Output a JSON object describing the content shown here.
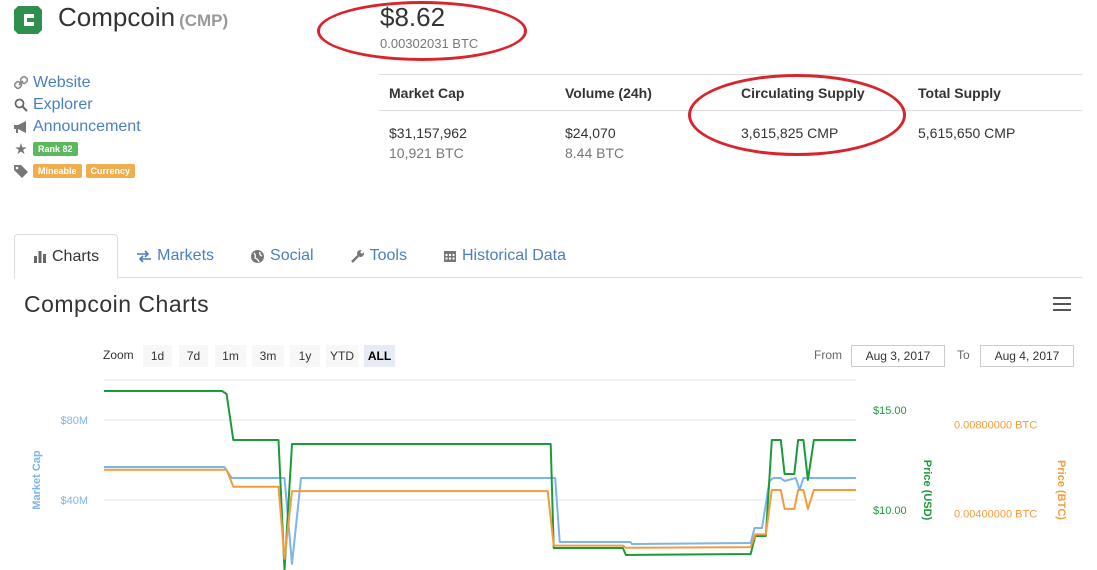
{
  "coin": {
    "name": "Compcoin",
    "symbol": "(CMP)"
  },
  "price": {
    "usd": "$8.62",
    "btc": "0.00302031 BTC"
  },
  "links": {
    "website": "Website",
    "explorer": "Explorer",
    "announcement": "Announcement",
    "rank": "Rank 82",
    "tags": [
      "Mineable",
      "Currency"
    ]
  },
  "stats": {
    "headers": [
      "Market Cap",
      "Volume (24h)",
      "Circulating Supply",
      "Total Supply"
    ],
    "market_cap_usd": "$31,157,962",
    "market_cap_btc": "10,921 BTC",
    "volume_usd": "$24,070",
    "volume_btc": "8.44 BTC",
    "circulating_supply": "3,615,825 CMP",
    "total_supply": "5,615,650 CMP"
  },
  "tabs": [
    "Charts",
    "Markets",
    "Social",
    "Tools",
    "Historical Data"
  ],
  "charts_title": "Compcoin Charts",
  "zoom": {
    "label": "Zoom",
    "buttons": [
      "1d",
      "7d",
      "1m",
      "3m",
      "1y",
      "YTD",
      "ALL"
    ],
    "active": "ALL"
  },
  "range": {
    "from_label": "From",
    "from": "Aug 3, 2017",
    "to_label": "To",
    "to": "Aug 4, 2017"
  },
  "colors": {
    "market_cap": "#7cb5ec",
    "price_usd": "#1a9b3a",
    "price_btc": "#f39c3c",
    "annotation": "#d9242b",
    "link": "#4a7fc0"
  },
  "chart_data": {
    "type": "line",
    "axes": {
      "market_cap": {
        "label": "Market Cap",
        "ticks": [
          "$40M",
          "$80M"
        ],
        "range": [
          0,
          100
        ]
      },
      "price_usd": {
        "label": "Price (USD)",
        "ticks": [
          "$10.00",
          "$15.00"
        ],
        "range": [
          6.5,
          16.5
        ]
      },
      "price_btc": {
        "label": "Price (BTC)",
        "ticks": [
          "0.00400000 BTC",
          "0.00800000 BTC"
        ],
        "range": [
          0.001,
          0.01
        ]
      }
    },
    "series": [
      {
        "name": "Market Cap",
        "axis": "market_cap",
        "color": "#7cb5ec",
        "values": [
          [
            0,
            56.5
          ],
          [
            0.16,
            56.5
          ],
          [
            0.17,
            51
          ],
          [
            0.24,
            51
          ],
          [
            0.25,
            8
          ],
          [
            0.262,
            51
          ],
          [
            0.6,
            51
          ],
          [
            0.606,
            19
          ],
          [
            0.7,
            19
          ],
          [
            0.702,
            18
          ],
          [
            0.86,
            18.5
          ],
          [
            0.865,
            26
          ],
          [
            0.875,
            26
          ],
          [
            0.885,
            49.5
          ],
          [
            0.89,
            51
          ],
          [
            0.9,
            51
          ],
          [
            0.905,
            49.5
          ],
          [
            0.92,
            51
          ],
          [
            0.925,
            45
          ],
          [
            0.93,
            51
          ],
          [
            1,
            51
          ]
        ]
      },
      {
        "name": "Price (USD)",
        "axis": "price_usd",
        "color": "#1a9b3a",
        "values": [
          [
            0,
            15.95
          ],
          [
            0.157,
            15.95
          ],
          [
            0.163,
            15.8
          ],
          [
            0.172,
            13.5
          ],
          [
            0.232,
            13.5
          ],
          [
            0.24,
            7
          ],
          [
            0.25,
            13.3
          ],
          [
            0.59,
            13.3
          ],
          [
            0.594,
            13.3
          ],
          [
            0.598,
            8.1
          ],
          [
            0.69,
            8.1
          ],
          [
            0.694,
            7.75
          ],
          [
            0.86,
            7.8
          ],
          [
            0.866,
            8.7
          ],
          [
            0.88,
            8.7
          ],
          [
            0.888,
            13.5
          ],
          [
            0.9,
            13.5
          ],
          [
            0.905,
            11.8
          ],
          [
            0.918,
            11.8
          ],
          [
            0.923,
            13.5
          ],
          [
            0.93,
            13.5
          ],
          [
            0.936,
            11.5
          ],
          [
            0.944,
            13.5
          ],
          [
            1,
            13.5
          ]
        ]
      },
      {
        "name": "Price (BTC)",
        "axis": "price_btc",
        "color": "#f39c3c",
        "values": [
          [
            0,
            0.00596
          ],
          [
            0.157,
            0.00596
          ],
          [
            0.163,
            0.00596
          ],
          [
            0.172,
            0.0052
          ],
          [
            0.232,
            0.0052
          ],
          [
            0.24,
            0.00195
          ],
          [
            0.25,
            0.005
          ],
          [
            0.59,
            0.005
          ],
          [
            0.598,
            0.00255
          ],
          [
            0.69,
            0.00255
          ],
          [
            0.694,
            0.00245
          ],
          [
            0.86,
            0.00248
          ],
          [
            0.866,
            0.00305
          ],
          [
            0.88,
            0.00305
          ],
          [
            0.888,
            0.00505
          ],
          [
            0.9,
            0.00505
          ],
          [
            0.905,
            0.0042
          ],
          [
            0.918,
            0.0042
          ],
          [
            0.923,
            0.00505
          ],
          [
            0.93,
            0.00505
          ],
          [
            0.936,
            0.0042
          ],
          [
            0.944,
            0.00505
          ],
          [
            1,
            0.00505
          ]
        ]
      }
    ]
  }
}
